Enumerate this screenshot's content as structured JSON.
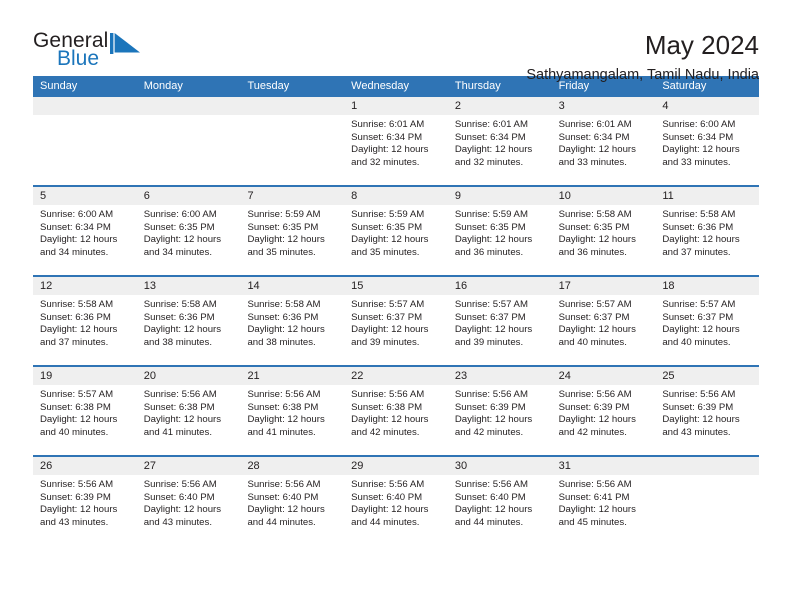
{
  "brand": {
    "name_top": "General",
    "name_bottom": "Blue",
    "flag_icon": "triangle-flag-icon",
    "color_dark": "#231f20",
    "color_blue": "#1b75bb"
  },
  "header": {
    "title": "May 2024",
    "subtitle": "Sathyamangalam, Tamil Nadu, India"
  },
  "theme": {
    "header_blue": "#2f74b5",
    "date_band": "#efefef",
    "text": "#231f20"
  },
  "calendar": {
    "weekday_headers": [
      "Sunday",
      "Monday",
      "Tuesday",
      "Wednesday",
      "Thursday",
      "Friday",
      "Saturday"
    ],
    "weeks": [
      {
        "dates": [
          "",
          "",
          "",
          "1",
          "2",
          "3",
          "4"
        ],
        "cells": [
          {
            "empty": true,
            "sunrise": "",
            "sunset": "",
            "daylight_line1": "",
            "daylight_line2": ""
          },
          {
            "empty": true,
            "sunrise": "",
            "sunset": "",
            "daylight_line1": "",
            "daylight_line2": ""
          },
          {
            "empty": true,
            "sunrise": "",
            "sunset": "",
            "daylight_line1": "",
            "daylight_line2": ""
          },
          {
            "empty": false,
            "sunrise": "Sunrise: 6:01 AM",
            "sunset": "Sunset: 6:34 PM",
            "daylight_line1": "Daylight: 12 hours",
            "daylight_line2": "and 32 minutes."
          },
          {
            "empty": false,
            "sunrise": "Sunrise: 6:01 AM",
            "sunset": "Sunset: 6:34 PM",
            "daylight_line1": "Daylight: 12 hours",
            "daylight_line2": "and 32 minutes."
          },
          {
            "empty": false,
            "sunrise": "Sunrise: 6:01 AM",
            "sunset": "Sunset: 6:34 PM",
            "daylight_line1": "Daylight: 12 hours",
            "daylight_line2": "and 33 minutes."
          },
          {
            "empty": false,
            "sunrise": "Sunrise: 6:00 AM",
            "sunset": "Sunset: 6:34 PM",
            "daylight_line1": "Daylight: 12 hours",
            "daylight_line2": "and 33 minutes."
          }
        ]
      },
      {
        "dates": [
          "5",
          "6",
          "7",
          "8",
          "9",
          "10",
          "11"
        ],
        "cells": [
          {
            "empty": false,
            "sunrise": "Sunrise: 6:00 AM",
            "sunset": "Sunset: 6:34 PM",
            "daylight_line1": "Daylight: 12 hours",
            "daylight_line2": "and 34 minutes."
          },
          {
            "empty": false,
            "sunrise": "Sunrise: 6:00 AM",
            "sunset": "Sunset: 6:35 PM",
            "daylight_line1": "Daylight: 12 hours",
            "daylight_line2": "and 34 minutes."
          },
          {
            "empty": false,
            "sunrise": "Sunrise: 5:59 AM",
            "sunset": "Sunset: 6:35 PM",
            "daylight_line1": "Daylight: 12 hours",
            "daylight_line2": "and 35 minutes."
          },
          {
            "empty": false,
            "sunrise": "Sunrise: 5:59 AM",
            "sunset": "Sunset: 6:35 PM",
            "daylight_line1": "Daylight: 12 hours",
            "daylight_line2": "and 35 minutes."
          },
          {
            "empty": false,
            "sunrise": "Sunrise: 5:59 AM",
            "sunset": "Sunset: 6:35 PM",
            "daylight_line1": "Daylight: 12 hours",
            "daylight_line2": "and 36 minutes."
          },
          {
            "empty": false,
            "sunrise": "Sunrise: 5:58 AM",
            "sunset": "Sunset: 6:35 PM",
            "daylight_line1": "Daylight: 12 hours",
            "daylight_line2": "and 36 minutes."
          },
          {
            "empty": false,
            "sunrise": "Sunrise: 5:58 AM",
            "sunset": "Sunset: 6:36 PM",
            "daylight_line1": "Daylight: 12 hours",
            "daylight_line2": "and 37 minutes."
          }
        ]
      },
      {
        "dates": [
          "12",
          "13",
          "14",
          "15",
          "16",
          "17",
          "18"
        ],
        "cells": [
          {
            "empty": false,
            "sunrise": "Sunrise: 5:58 AM",
            "sunset": "Sunset: 6:36 PM",
            "daylight_line1": "Daylight: 12 hours",
            "daylight_line2": "and 37 minutes."
          },
          {
            "empty": false,
            "sunrise": "Sunrise: 5:58 AM",
            "sunset": "Sunset: 6:36 PM",
            "daylight_line1": "Daylight: 12 hours",
            "daylight_line2": "and 38 minutes."
          },
          {
            "empty": false,
            "sunrise": "Sunrise: 5:58 AM",
            "sunset": "Sunset: 6:36 PM",
            "daylight_line1": "Daylight: 12 hours",
            "daylight_line2": "and 38 minutes."
          },
          {
            "empty": false,
            "sunrise": "Sunrise: 5:57 AM",
            "sunset": "Sunset: 6:37 PM",
            "daylight_line1": "Daylight: 12 hours",
            "daylight_line2": "and 39 minutes."
          },
          {
            "empty": false,
            "sunrise": "Sunrise: 5:57 AM",
            "sunset": "Sunset: 6:37 PM",
            "daylight_line1": "Daylight: 12 hours",
            "daylight_line2": "and 39 minutes."
          },
          {
            "empty": false,
            "sunrise": "Sunrise: 5:57 AM",
            "sunset": "Sunset: 6:37 PM",
            "daylight_line1": "Daylight: 12 hours",
            "daylight_line2": "and 40 minutes."
          },
          {
            "empty": false,
            "sunrise": "Sunrise: 5:57 AM",
            "sunset": "Sunset: 6:37 PM",
            "daylight_line1": "Daylight: 12 hours",
            "daylight_line2": "and 40 minutes."
          }
        ]
      },
      {
        "dates": [
          "19",
          "20",
          "21",
          "22",
          "23",
          "24",
          "25"
        ],
        "cells": [
          {
            "empty": false,
            "sunrise": "Sunrise: 5:57 AM",
            "sunset": "Sunset: 6:38 PM",
            "daylight_line1": "Daylight: 12 hours",
            "daylight_line2": "and 40 minutes."
          },
          {
            "empty": false,
            "sunrise": "Sunrise: 5:56 AM",
            "sunset": "Sunset: 6:38 PM",
            "daylight_line1": "Daylight: 12 hours",
            "daylight_line2": "and 41 minutes."
          },
          {
            "empty": false,
            "sunrise": "Sunrise: 5:56 AM",
            "sunset": "Sunset: 6:38 PM",
            "daylight_line1": "Daylight: 12 hours",
            "daylight_line2": "and 41 minutes."
          },
          {
            "empty": false,
            "sunrise": "Sunrise: 5:56 AM",
            "sunset": "Sunset: 6:38 PM",
            "daylight_line1": "Daylight: 12 hours",
            "daylight_line2": "and 42 minutes."
          },
          {
            "empty": false,
            "sunrise": "Sunrise: 5:56 AM",
            "sunset": "Sunset: 6:39 PM",
            "daylight_line1": "Daylight: 12 hours",
            "daylight_line2": "and 42 minutes."
          },
          {
            "empty": false,
            "sunrise": "Sunrise: 5:56 AM",
            "sunset": "Sunset: 6:39 PM",
            "daylight_line1": "Daylight: 12 hours",
            "daylight_line2": "and 42 minutes."
          },
          {
            "empty": false,
            "sunrise": "Sunrise: 5:56 AM",
            "sunset": "Sunset: 6:39 PM",
            "daylight_line1": "Daylight: 12 hours",
            "daylight_line2": "and 43 minutes."
          }
        ]
      },
      {
        "dates": [
          "26",
          "27",
          "28",
          "29",
          "30",
          "31",
          ""
        ],
        "cells": [
          {
            "empty": false,
            "sunrise": "Sunrise: 5:56 AM",
            "sunset": "Sunset: 6:39 PM",
            "daylight_line1": "Daylight: 12 hours",
            "daylight_line2": "and 43 minutes."
          },
          {
            "empty": false,
            "sunrise": "Sunrise: 5:56 AM",
            "sunset": "Sunset: 6:40 PM",
            "daylight_line1": "Daylight: 12 hours",
            "daylight_line2": "and 43 minutes."
          },
          {
            "empty": false,
            "sunrise": "Sunrise: 5:56 AM",
            "sunset": "Sunset: 6:40 PM",
            "daylight_line1": "Daylight: 12 hours",
            "daylight_line2": "and 44 minutes."
          },
          {
            "empty": false,
            "sunrise": "Sunrise: 5:56 AM",
            "sunset": "Sunset: 6:40 PM",
            "daylight_line1": "Daylight: 12 hours",
            "daylight_line2": "and 44 minutes."
          },
          {
            "empty": false,
            "sunrise": "Sunrise: 5:56 AM",
            "sunset": "Sunset: 6:40 PM",
            "daylight_line1": "Daylight: 12 hours",
            "daylight_line2": "and 44 minutes."
          },
          {
            "empty": false,
            "sunrise": "Sunrise: 5:56 AM",
            "sunset": "Sunset: 6:41 PM",
            "daylight_line1": "Daylight: 12 hours",
            "daylight_line2": "and 45 minutes."
          },
          {
            "empty": true,
            "sunrise": "",
            "sunset": "",
            "daylight_line1": "",
            "daylight_line2": ""
          }
        ]
      }
    ]
  }
}
